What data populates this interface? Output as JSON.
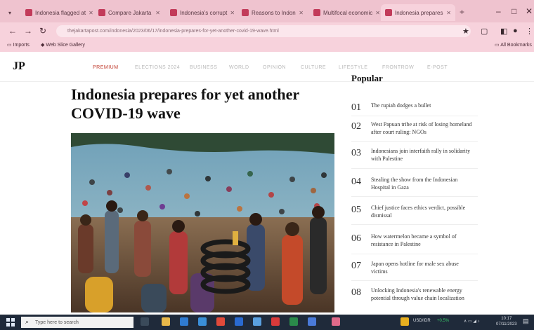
{
  "browser": {
    "tabs": [
      {
        "label": "Indonesia flagged at",
        "active": false
      },
      {
        "label": "Compare Jakarta",
        "active": false
      },
      {
        "label": "Indonesia's corrupt",
        "active": false
      },
      {
        "label": "Reasons to Indon",
        "active": false
      },
      {
        "label": "Multifocal economic",
        "active": false
      },
      {
        "label": "Indonesia prepares",
        "active": true
      }
    ],
    "new_tab": "+",
    "window_controls": {
      "minimize": "–",
      "maximize": "□",
      "close": "✕"
    },
    "url": "thejakartapost.com/indonesia/2023/06/17/indonesia-prepares-for-yet-another-covid-19-wave.html",
    "bookmarks": {
      "left": [
        {
          "label": "Imports"
        },
        {
          "label": "Web Slice Gallery"
        }
      ],
      "right": "All Bookmarks"
    }
  },
  "site": {
    "logo": "JP",
    "nav": [
      {
        "label": "PREMIUM",
        "active": true
      },
      {
        "label": "ELECTIONS 2024",
        "active": false
      },
      {
        "label": "BUSINESS",
        "active": false
      },
      {
        "label": "WORLD",
        "active": false
      },
      {
        "label": "OPINION",
        "active": false
      },
      {
        "label": "CULTURE",
        "active": false
      },
      {
        "label": "LIFESTYLE",
        "active": false
      },
      {
        "label": "FRONTROW",
        "active": false
      },
      {
        "label": "E-POST",
        "active": false
      }
    ]
  },
  "article": {
    "headline": "Indonesia prepares for yet another COVID-19 wave"
  },
  "popular": {
    "title": "Popular",
    "items": [
      {
        "num": "01",
        "text": "The rupiah dodges a bullet"
      },
      {
        "num": "02",
        "text": "West Papuan tribe at risk of losing homeland after court ruling: NGOs"
      },
      {
        "num": "03",
        "text": "Indonesians join interfaith rally in solidarity with Palestine"
      },
      {
        "num": "04",
        "text": "Stealing the show from the Indonesian Hospital in Gaza"
      },
      {
        "num": "05",
        "text": "Chief justice faces ethics verdict, possible dismissal"
      },
      {
        "num": "06",
        "text": "How watermelon became a symbol of resistance in Palestine"
      },
      {
        "num": "07",
        "text": "Japan opens hotline for male sex abuse victims"
      },
      {
        "num": "08",
        "text": "Unlocking Indonesia's renewable energy potential through value chain localization"
      }
    ]
  },
  "taskbar": {
    "search_placeholder": "Type here to search",
    "stock": "USD/IDR",
    "stock_change": "+0.5%",
    "time": "10:17",
    "date": "07/11/2023"
  },
  "colors": {
    "accent": "#c0392b",
    "chrome": "#f7d2dc",
    "taskbar": "#1f2a3a"
  }
}
